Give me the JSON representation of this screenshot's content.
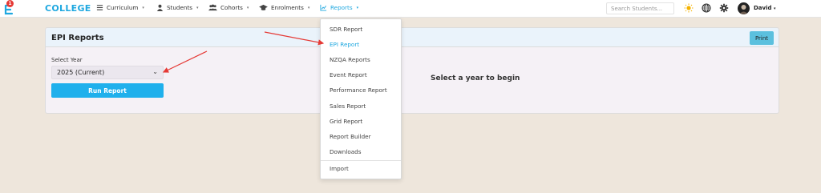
{
  "navbar": {
    "notification_count": "1",
    "brand": "COLLEGE",
    "items": [
      {
        "label": "Curriculum",
        "icon": "list-icon"
      },
      {
        "label": "Students",
        "icon": "user-icon"
      },
      {
        "label": "Cohorts",
        "icon": "users-icon"
      },
      {
        "label": "Enrolments",
        "icon": "graduation-cap-icon"
      },
      {
        "label": "Reports",
        "icon": "chart-line-icon",
        "active": true
      }
    ],
    "search_placeholder": "Search Students...",
    "username": "David",
    "accent_color": "#1fa8e0"
  },
  "card": {
    "title": "EPI Reports",
    "print_label": "Print",
    "select_label": "Select Year",
    "select_value": "2025 (Current)",
    "run_label": "Run Report",
    "empty_message": "Select a year to begin"
  },
  "reports_menu": {
    "items": [
      "SDR Report",
      "EPI Report",
      "NZQA Reports",
      "Event Report",
      "Performance Report",
      "Sales Report",
      "Grid Report",
      "Report Builder",
      "Downloads"
    ],
    "active_item": "EPI Report",
    "footer_item": "Import"
  },
  "annotation_color": "#e53935"
}
